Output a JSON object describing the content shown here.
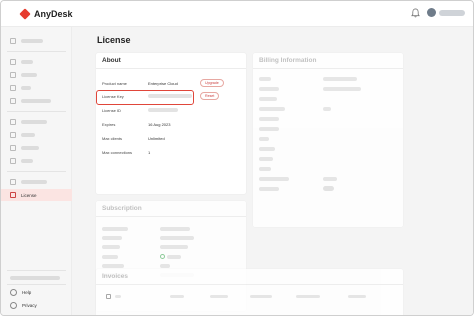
{
  "app": {
    "name": "AnyDesk"
  },
  "page_title": "License",
  "sidebar": {
    "items": [
      {
        "blur_width": 22
      },
      {
        "blur_width": 12
      },
      {
        "blur_width": 16
      },
      {
        "blur_width": 10
      },
      {
        "blur_width": 30
      },
      {
        "blur_width": 26
      },
      {
        "blur_width": 14
      },
      {
        "blur_width": 18
      },
      {
        "blur_width": 12
      },
      {
        "blur_width": 26
      }
    ],
    "active_label": "License",
    "footer": {
      "help_label": "Help",
      "privacy_label": "Privacy"
    }
  },
  "about": {
    "title": "About",
    "rows": [
      {
        "label": "Product name",
        "value": "Enterprise Cloud"
      },
      {
        "label": "License Key",
        "value": ""
      },
      {
        "label": "License ID",
        "value": ""
      },
      {
        "label": "Expires",
        "value": "16 Aug 2023"
      },
      {
        "label": "Max clients",
        "value": "Unlimited"
      },
      {
        "label": "Max connections",
        "value": "1"
      }
    ],
    "upgrade_label": "Upgrade",
    "reset_label": "Reset"
  },
  "subscription": {
    "title": "Subscription"
  },
  "billing": {
    "title": "Billing Information"
  },
  "invoices": {
    "title": "Invoices"
  },
  "colors": {
    "brand": "#e63c2f",
    "highlight": "#e0463a",
    "active_bg": "#fbe4e2"
  }
}
